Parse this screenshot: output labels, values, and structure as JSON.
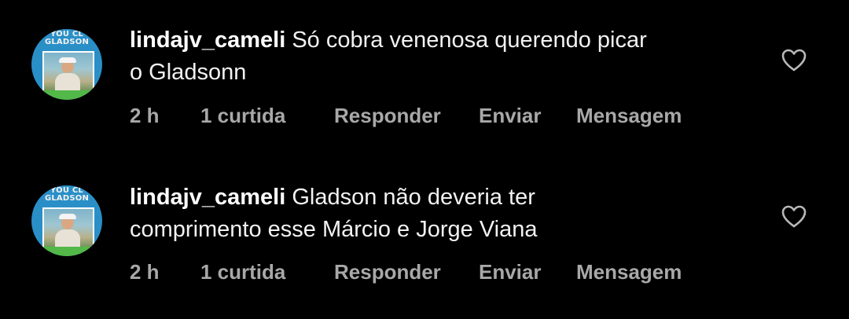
{
  "comments": [
    {
      "username": "lindajv_cameli",
      "text_line1": "Só cobra venenosa querendo picar",
      "text_line2": "o Gladsonn",
      "time": "2 h",
      "likes": "1 curtida",
      "reply": "Responder",
      "send": "Enviar",
      "message": "Mensagem",
      "avatar_banner_line1": "YOU CL",
      "avatar_banner_line2": "GLADSON",
      "like_icon": "heart-outline-icon"
    },
    {
      "username": "lindajv_cameli",
      "text_line1": "Gladson não deveria ter",
      "text_line2": "comprimento esse Márcio e Jorge Viana",
      "time": "2 h",
      "likes": "1 curtida",
      "reply": "Responder",
      "send": "Enviar",
      "message": "Mensagem",
      "avatar_banner_line1": "YOU CL",
      "avatar_banner_line2": "GLADSON",
      "like_icon": "heart-outline-icon"
    }
  ],
  "colors": {
    "background": "#000000",
    "primary_text": "#f2f2f2",
    "secondary_text": "#a8a8a8",
    "avatar_blue": "#2a8fc7",
    "avatar_green": "#52b848"
  }
}
